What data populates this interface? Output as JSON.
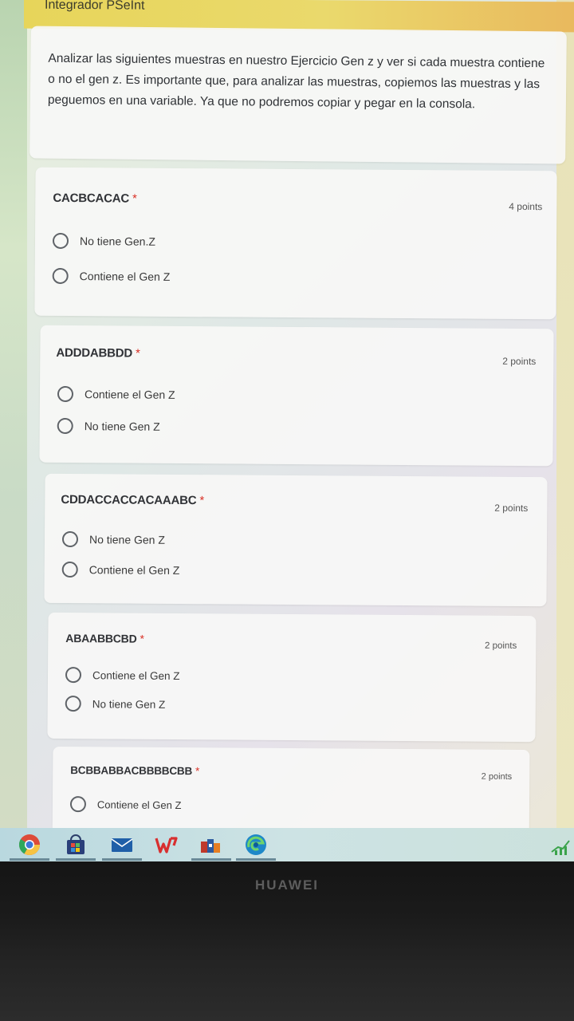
{
  "header": {
    "title": "Integrador PSeInt"
  },
  "description": "Analizar las siguientes muestras en nuestro Ejercicio Gen z y ver si cada muestra contiene o no el gen z. Es importante que, para analizar las muestras, copiemos las muestras y las peguemos en una variable. Ya que no podremos copiar y pegar en la consola.",
  "questions": [
    {
      "title": "CACBCACAC",
      "required": "*",
      "points": "4 points",
      "options": [
        "No tiene Gen.Z",
        "Contiene el Gen Z"
      ]
    },
    {
      "title": "ADDDABBDD",
      "required": "*",
      "points": "2 points",
      "options": [
        "Contiene el Gen Z",
        "No tiene Gen Z"
      ]
    },
    {
      "title": "CDDACCACCACAAABC",
      "required": "*",
      "points": "2 points",
      "options": [
        "No tiene Gen Z",
        "Contiene el Gen Z"
      ]
    },
    {
      "title": "ABAABBCBD",
      "required": "*",
      "points": "2 points",
      "options": [
        "Contiene el Gen Z",
        "No tiene Gen Z"
      ]
    },
    {
      "title": "BCBBABBACBBBBCBB",
      "required": "*",
      "points": "2 points",
      "options": [
        "Contiene el Gen Z"
      ]
    }
  ],
  "taskbar": {
    "icons": [
      "chrome-icon",
      "store-icon",
      "mail-icon",
      "wps-office-icon",
      "office-apps-icon",
      "edge-icon"
    ]
  },
  "device": {
    "brand": "HUAWEI"
  }
}
